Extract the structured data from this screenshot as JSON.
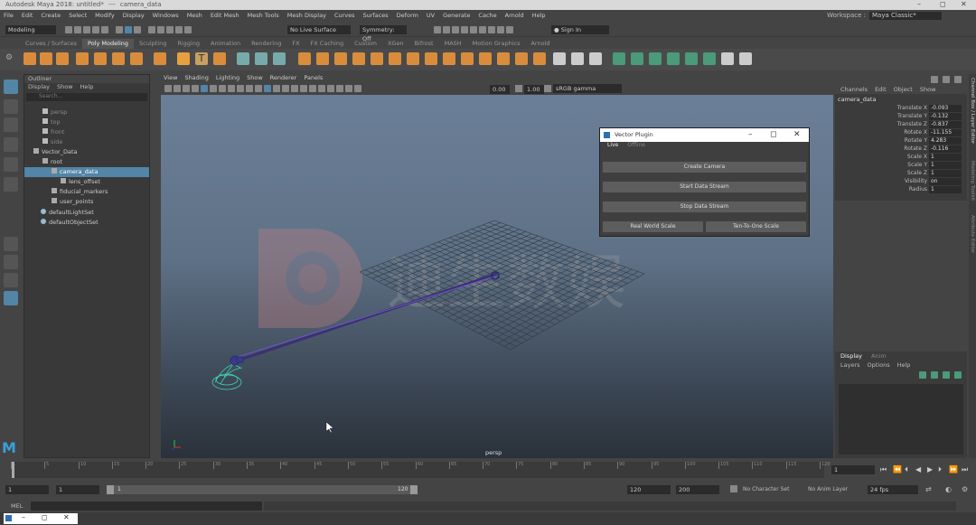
{
  "titlebar": {
    "app_title": "Autodesk Maya 2018: untitled*",
    "separator": "---",
    "object": "camera_data",
    "min": "–",
    "max": "◻",
    "close": "✕"
  },
  "menu": [
    "File",
    "Edit",
    "Create",
    "Select",
    "Modify",
    "Display",
    "Windows",
    "Mesh",
    "Edit Mesh",
    "Mesh Tools",
    "Mesh Display",
    "Curves",
    "Surfaces",
    "Deform",
    "UV",
    "Generate",
    "Cache",
    "Arnold",
    "Help"
  ],
  "workspace": {
    "label": "Workspace :",
    "value": "Maya Classic*"
  },
  "statusline": {
    "mode": "Modeling",
    "live_surface": "No Live Surface",
    "symmetry": "Symmetry: Off",
    "sign_in": "Sign In"
  },
  "shelf_tabs": [
    "Curves / Surfaces",
    "Poly Modeling",
    "Sculpting",
    "Rigging",
    "Animation",
    "Rendering",
    "FX",
    "FX Caching",
    "Custom",
    "XGen",
    "Bifrost",
    "MASH",
    "Motion Graphics",
    "Arnold"
  ],
  "shelf_active": "Poly Modeling",
  "outliner": {
    "title": "Outliner",
    "menu": [
      "Display",
      "Show",
      "Help"
    ],
    "search_placeholder": "Search...",
    "items": [
      "persp",
      "top",
      "front",
      "side",
      "Vector_Data",
      "root",
      "camera_data",
      "lens_offset",
      "fiducial_markers",
      "user_points",
      "defaultLightSet",
      "defaultObjectSet"
    ]
  },
  "viewport": {
    "menu": [
      "View",
      "Shading",
      "Lighting",
      "Show",
      "Renderer",
      "Panels"
    ],
    "field1": "0.00",
    "field2": "1.00",
    "colorspace": "sRGB gamma",
    "camera_label": "persp"
  },
  "watermark": "迪生数娱",
  "plugin": {
    "title": "Vector Plugin",
    "tabs": [
      "Live",
      "Offline"
    ],
    "create_camera": "Create Camera",
    "start_stream": "Start Data Stream",
    "stop_stream": "Stop Data Stream",
    "real_world_scale": "Real World Scale",
    "ten_to_one_scale": "Ten-To-One Scale"
  },
  "channelbox": {
    "menu": [
      "Channels",
      "Edit",
      "Object",
      "Show"
    ],
    "object": "camera_data",
    "channels": [
      {
        "name": "Translate X",
        "value": "-0.093"
      },
      {
        "name": "Translate Y",
        "value": "-0.132"
      },
      {
        "name": "Translate Z",
        "value": "-0.837"
      },
      {
        "name": "Rotate X",
        "value": "-11.155"
      },
      {
        "name": "Rotate Y",
        "value": "4.283"
      },
      {
        "name": "Rotate Z",
        "value": "-0.116"
      },
      {
        "name": "Scale X",
        "value": "1"
      },
      {
        "name": "Scale Y",
        "value": "1"
      },
      {
        "name": "Scale Z",
        "value": "1"
      },
      {
        "name": "Visibility",
        "value": "on"
      },
      {
        "name": "Radius",
        "value": "1"
      }
    ],
    "side_tabs": [
      "Channel Box / Layer Editor",
      "Modeling Toolkit",
      "Attribute Editor"
    ]
  },
  "layers": {
    "tabs": [
      "Display",
      "Anim"
    ],
    "menu": [
      "Layers",
      "Options",
      "Help"
    ]
  },
  "timeline": {
    "ticks": [
      "1",
      "5",
      "10",
      "15",
      "20",
      "25",
      "30",
      "35",
      "40",
      "45",
      "50",
      "55",
      "60",
      "65",
      "70",
      "75",
      "80",
      "85",
      "90",
      "95",
      "100",
      "105",
      "110",
      "115",
      "120"
    ],
    "current": "1"
  },
  "range": {
    "start": "1",
    "start2": "1",
    "slider_start": "1",
    "slider_end": "120",
    "end": "120",
    "end2": "200",
    "character_set": "No Character Set",
    "anim_layer": "No Anim Layer",
    "fps": "24 fps"
  },
  "mel": {
    "label": "MEL"
  },
  "accent": "#5285a6"
}
